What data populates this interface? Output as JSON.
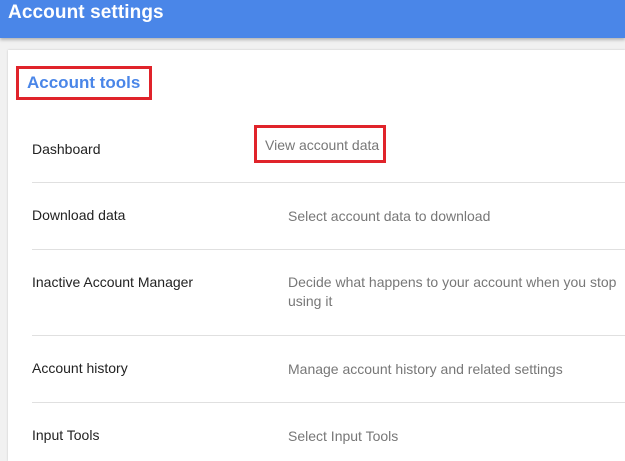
{
  "header": {
    "title": "Account settings",
    "background": "#4a86e8"
  },
  "section": {
    "title": "Account tools",
    "title_color": "#4a86e8",
    "highlight_color": "#e0232a"
  },
  "rows": [
    {
      "label": "Dashboard",
      "description": "View account data"
    },
    {
      "label": "Download data",
      "description": "Select account data to download"
    },
    {
      "label": "Inactive Account Manager",
      "description": "Decide what happens to your account when you stop using it"
    },
    {
      "label": "Account history",
      "description": "Manage account history and related settings"
    },
    {
      "label": "Input Tools",
      "description": "Select Input Tools"
    }
  ]
}
